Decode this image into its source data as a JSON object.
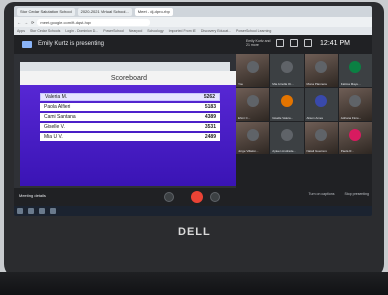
{
  "browser": {
    "tabs": [
      "Stor Cedar Salutation School",
      "2020-2021 Virtual School...",
      "Meet - dj-dpro-rbp"
    ],
    "address": "meet.google.com/ft-dqst-hqv",
    "bookmarks": [
      "Apps",
      "Stor Cedar Schools",
      "Login - Dominion D...",
      "PowerSchool",
      "Nearpod",
      "Schoology",
      "Imported From IE",
      "Discovery Educat...",
      "PowerSchool Learning"
    ]
  },
  "meet": {
    "presenting_text": "Emily Kurtz is presenting",
    "user_chip": "Emily Kurtz and 21 more",
    "time": "12:41 PM",
    "meeting_details": "Meeting details",
    "bottom_right": [
      "Turn on captions",
      "Stop presenting"
    ]
  },
  "scoreboard": {
    "title": "Scoreboard",
    "rows": [
      {
        "name": "Valeria M.",
        "score": "5262"
      },
      {
        "name": "Paola Alfieri",
        "score": "5183"
      },
      {
        "name": "Cami Santana",
        "score": "4389"
      },
      {
        "name": "Giselle V.",
        "score": "3531"
      },
      {
        "name": "Mia U V.",
        "score": "2489"
      }
    ]
  },
  "participants": [
    {
      "name": "You",
      "color": "#5f6368",
      "video": true
    },
    {
      "name": "Mia Arnolla Ot...",
      "color": "#5f6368",
      "video": false
    },
    {
      "name": "Mona Plannera",
      "color": "#5f6368",
      "video": true
    },
    {
      "name": "Fatima Maye...",
      "color": "#0b8043",
      "video": false
    },
    {
      "name": "Ehmi C...",
      "color": "#5f6368",
      "video": true
    },
    {
      "name": "Giselle Valera...",
      "color": "#e37400",
      "video": false
    },
    {
      "name": "Alison Ames",
      "color": "#3949ab",
      "video": false
    },
    {
      "name": "Adriana Flore...",
      "color": "#5f6368",
      "video": true
    },
    {
      "name": "Jorge Villalon...",
      "color": "#5f6368",
      "video": true
    },
    {
      "name": "Ayleen Andrade...",
      "color": "#5f6368",
      "video": false
    },
    {
      "name": "Natali Guerrero",
      "color": "#5f6368",
      "video": true
    },
    {
      "name": "Paola R...",
      "color": "#d81b60",
      "video": true
    }
  ],
  "laptop": {
    "brand": "DELL"
  }
}
